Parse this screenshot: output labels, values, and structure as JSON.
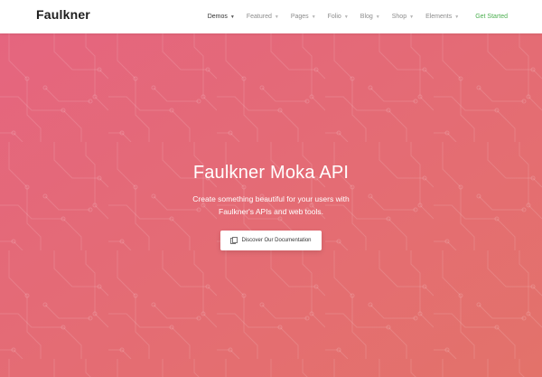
{
  "header": {
    "logo": "Faulkner",
    "nav": [
      {
        "label": "Demos",
        "active": true
      },
      {
        "label": "Featured",
        "active": false
      },
      {
        "label": "Pages",
        "active": false
      },
      {
        "label": "Folio",
        "active": false
      },
      {
        "label": "Blog",
        "active": false
      },
      {
        "label": "Shop",
        "active": false
      },
      {
        "label": "Elements",
        "active": false
      }
    ],
    "cta": "Get Started"
  },
  "hero": {
    "title": "Faulkner Moka API",
    "subtitle_line1": "Create something beautiful for your users with",
    "subtitle_line2": "Faulkner's APIs and web tools.",
    "button_label": "Discover Our Documentation",
    "button_icon": "documents-icon"
  },
  "colors": {
    "gradient_start": "#e5657f",
    "gradient_end": "#e3726a",
    "accent_green": "#4caf50",
    "text_white": "#ffffff"
  }
}
